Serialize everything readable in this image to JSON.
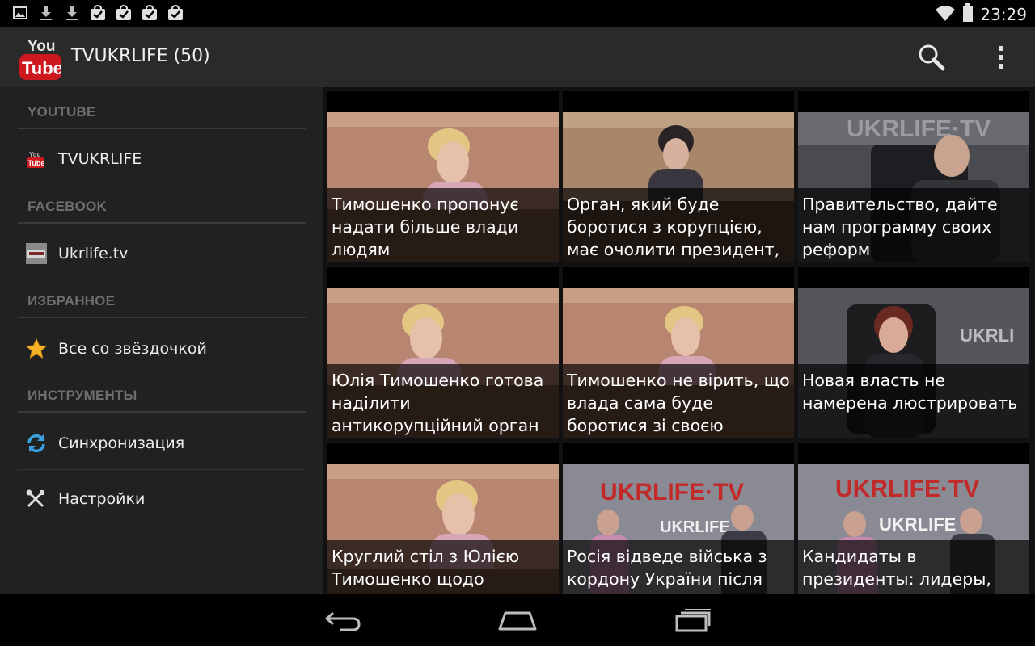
{
  "status_bar": {
    "time": "23:29",
    "left_icons": [
      "image-icon",
      "download-icon",
      "download-icon",
      "shopping-bag-check-icon",
      "shopping-bag-check-icon",
      "shopping-bag-check-icon",
      "shopping-bag-check-icon"
    ],
    "right_icons": [
      "wifi-icon",
      "battery-icon"
    ]
  },
  "action_bar": {
    "title": "TVUKRLIFE (50)",
    "logo_top": "You",
    "logo_bottom": "Tube",
    "actions": [
      "search-icon",
      "overflow-menu-icon"
    ]
  },
  "drawer": {
    "sections": [
      {
        "header": "YOUTUBE",
        "items": [
          {
            "label": "TVUKRLIFE",
            "icon": "youtube-icon"
          }
        ]
      },
      {
        "header": "FACEBOOK",
        "items": [
          {
            "label": "Ukrlife.tv",
            "icon": "ukrlife-page-icon"
          }
        ]
      },
      {
        "header": "ИЗБРАННОЕ",
        "items": [
          {
            "label": "Все со звёздочкой",
            "icon": "star-icon"
          }
        ]
      },
      {
        "header": "ИНСТРУМЕНТЫ",
        "items": [
          {
            "label": "Синхронизация",
            "icon": "sync-icon"
          },
          {
            "label": "Настройки",
            "icon": "settings-tools-icon"
          }
        ]
      }
    ]
  },
  "videos": [
    {
      "title": "Тимошенко пропонує надати більше влади людям",
      "thumb": "press-conference"
    },
    {
      "title": "Орган, який буде боротися з корупцією, має очолити президент,",
      "thumb": "press-conference"
    },
    {
      "title": "Правительство, дайте нам программу своих реформ",
      "thumb": "studio-speaker"
    },
    {
      "title": "Юлія Тимошенко готова наділити антикорупційний орган",
      "thumb": "press-conference"
    },
    {
      "title": "Тимошенко не вірить, що влада сама буде боротися зі своєю",
      "thumb": "press-conference"
    },
    {
      "title": "Новая власть не намерена люстрировать",
      "thumb": "studio-speaker"
    },
    {
      "title": "Круглий стіл з Юлією Тимошенко щодо",
      "thumb": "press-conference"
    },
    {
      "title": "Росія відведе війська з кордону України після",
      "thumb": "studio-panel"
    },
    {
      "title": "Кандидаты в президенты: лидеры,",
      "thumb": "studio-panel"
    }
  ],
  "nav_bar": {
    "buttons": [
      "back-icon",
      "home-icon",
      "recents-icon"
    ]
  },
  "colors": {
    "action_bar": "#2a2a2a",
    "drawer": "#212121",
    "section_header": "#6e6e6e",
    "youtube_red": "#cc181e",
    "star": "#f6b323",
    "sync": "#3aa0e0"
  }
}
